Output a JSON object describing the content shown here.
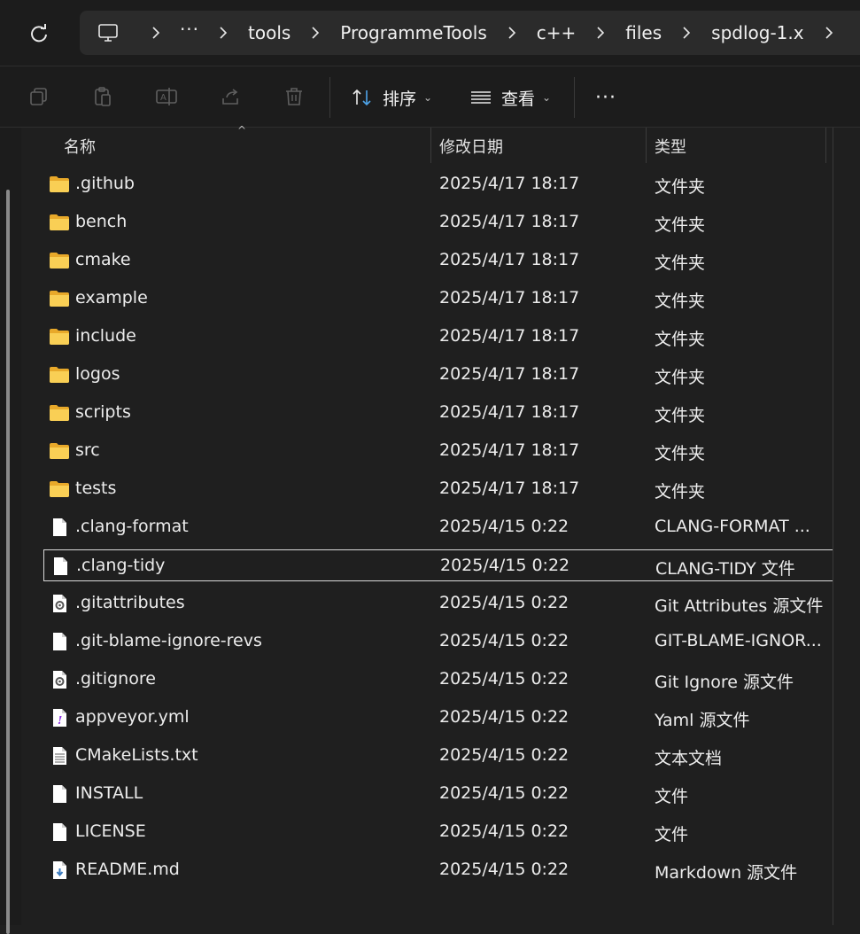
{
  "address": {
    "more": "···",
    "crumbs": [
      "tools",
      "ProgrammeTools",
      "c++",
      "files",
      "spdlog-1.x"
    ]
  },
  "toolbar": {
    "sort_label": "排序",
    "view_label": "查看",
    "more_label": "···"
  },
  "columns": {
    "name": "名称",
    "date": "修改日期",
    "type": "类型"
  },
  "files": [
    {
      "name": ".github",
      "date": "2025/4/17 18:17",
      "type": "文件夹",
      "icon": "folder-icon"
    },
    {
      "name": "bench",
      "date": "2025/4/17 18:17",
      "type": "文件夹",
      "icon": "folder-icon"
    },
    {
      "name": "cmake",
      "date": "2025/4/17 18:17",
      "type": "文件夹",
      "icon": "folder-icon"
    },
    {
      "name": "example",
      "date": "2025/4/17 18:17",
      "type": "文件夹",
      "icon": "folder-icon"
    },
    {
      "name": "include",
      "date": "2025/4/17 18:17",
      "type": "文件夹",
      "icon": "folder-icon"
    },
    {
      "name": "logos",
      "date": "2025/4/17 18:17",
      "type": "文件夹",
      "icon": "folder-icon"
    },
    {
      "name": "scripts",
      "date": "2025/4/17 18:17",
      "type": "文件夹",
      "icon": "folder-icon"
    },
    {
      "name": "src",
      "date": "2025/4/17 18:17",
      "type": "文件夹",
      "icon": "folder-icon"
    },
    {
      "name": "tests",
      "date": "2025/4/17 18:17",
      "type": "文件夹",
      "icon": "folder-icon"
    },
    {
      "name": ".clang-format",
      "date": "2025/4/15 0:22",
      "type": "CLANG-FORMAT ...",
      "icon": "file-icon"
    },
    {
      "name": ".clang-tidy",
      "date": "2025/4/15 0:22",
      "type": "CLANG-TIDY 文件",
      "icon": "file-icon",
      "selected": true
    },
    {
      "name": ".gitattributes",
      "date": "2025/4/15 0:22",
      "type": "Git Attributes 源文件",
      "icon": "config-file-icon"
    },
    {
      "name": ".git-blame-ignore-revs",
      "date": "2025/4/15 0:22",
      "type": "GIT-BLAME-IGNOR...",
      "icon": "file-icon"
    },
    {
      "name": ".gitignore",
      "date": "2025/4/15 0:22",
      "type": "Git Ignore 源文件",
      "icon": "config-file-icon"
    },
    {
      "name": "appveyor.yml",
      "date": "2025/4/15 0:22",
      "type": "Yaml 源文件",
      "icon": "yaml-file-icon"
    },
    {
      "name": "CMakeLists.txt",
      "date": "2025/4/15 0:22",
      "type": "文本文档",
      "icon": "text-file-icon"
    },
    {
      "name": "INSTALL",
      "date": "2025/4/15 0:22",
      "type": "文件",
      "icon": "file-icon"
    },
    {
      "name": "LICENSE",
      "date": "2025/4/15 0:22",
      "type": "文件",
      "icon": "file-icon"
    },
    {
      "name": "README.md",
      "date": "2025/4/15 0:22",
      "type": "Markdown 源文件",
      "icon": "markdown-file-icon"
    }
  ]
}
